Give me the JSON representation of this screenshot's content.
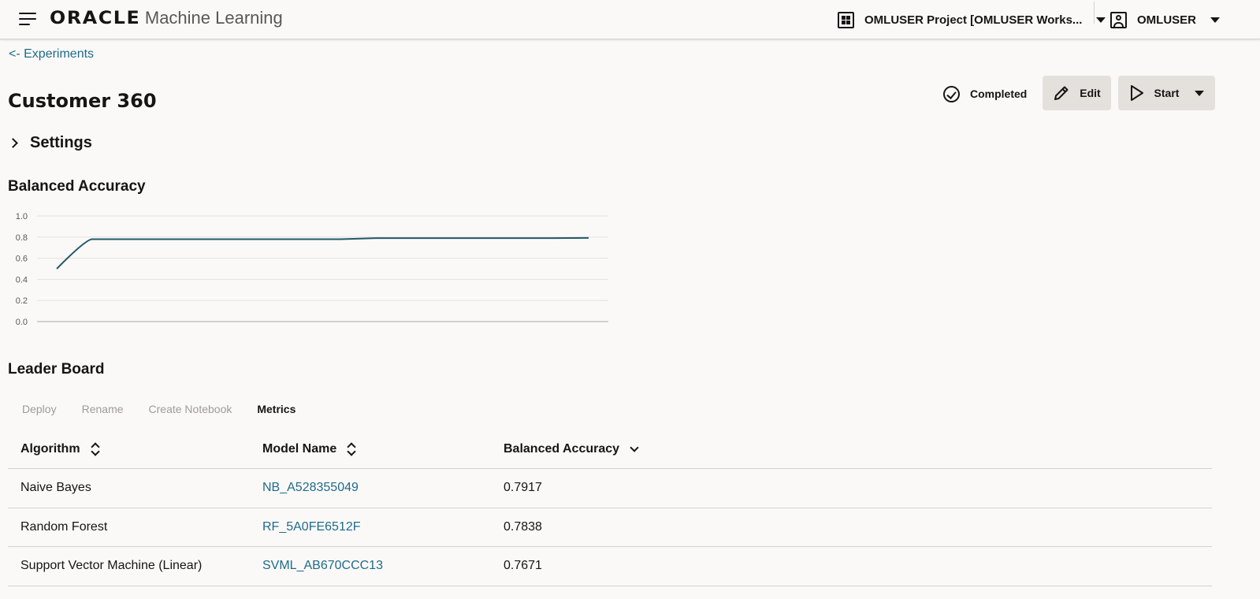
{
  "header": {
    "brand": "ORACLE",
    "product": "Machine Learning",
    "project_selector": "OMLUSER Project [OMLUSER Works...",
    "user": "OMLUSER"
  },
  "breadcrumb": {
    "back_label": "<- Experiments"
  },
  "page": {
    "title": "Customer 360",
    "status": "Completed",
    "edit_label": "Edit",
    "start_label": "Start"
  },
  "settings": {
    "label": "Settings"
  },
  "chart_section": {
    "title": "Balanced Accuracy"
  },
  "chart_data": {
    "type": "line",
    "title": "",
    "xlabel": "",
    "ylabel": "",
    "ylim": [
      0,
      1.0
    ],
    "yticks": [
      "0.0",
      "0.2",
      "0.4",
      "0.6",
      "0.8",
      "1.0"
    ],
    "grid": true,
    "series": [
      {
        "values": [
          0.5,
          0.78,
          0.78,
          0.78,
          0.78,
          0.78,
          0.78,
          0.78,
          0.78,
          0.79,
          0.79,
          0.79,
          0.79,
          0.79,
          0.79,
          0.7917
        ],
        "color": "#1f5a66"
      }
    ]
  },
  "leader_board": {
    "title": "Leader Board",
    "toolbar": [
      "Deploy",
      "Rename",
      "Create Notebook",
      "Metrics"
    ],
    "columns": [
      "Algorithm",
      "Model Name",
      "Balanced Accuracy"
    ],
    "rows": [
      {
        "algorithm": "Naive Bayes",
        "model": "NB_A528355049",
        "accuracy": "0.7917"
      },
      {
        "algorithm": "Random Forest",
        "model": "RF_5A0FE6512F",
        "accuracy": "0.7838"
      },
      {
        "algorithm": "Support Vector Machine (Linear)",
        "model": "SVML_AB670CCC13",
        "accuracy": "0.7671"
      }
    ]
  }
}
